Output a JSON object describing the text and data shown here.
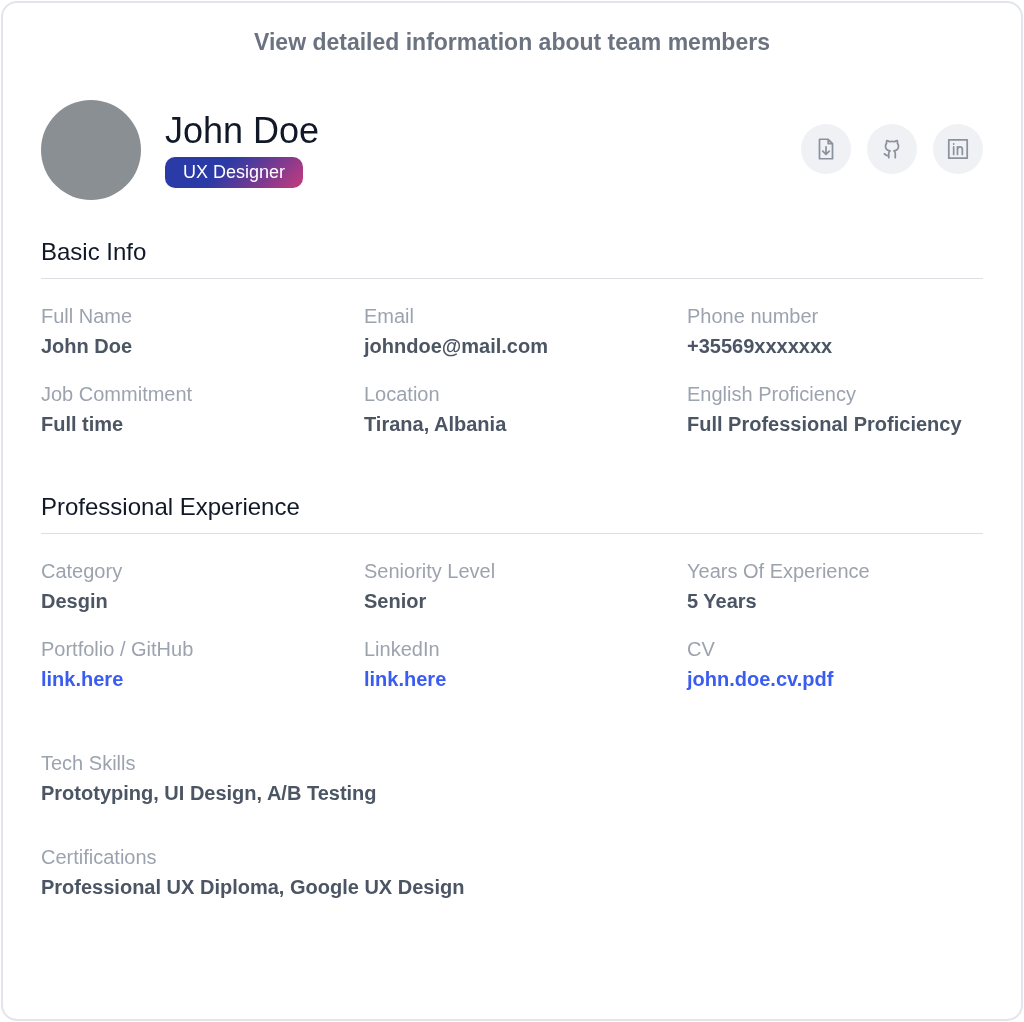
{
  "header": "View detailed information about team members",
  "profile": {
    "name": "John Doe",
    "role": "UX Designer"
  },
  "actions": [
    {
      "kind": "file-download"
    },
    {
      "kind": "github"
    },
    {
      "kind": "linkedin"
    }
  ],
  "sections": [
    {
      "title": "Basic Info",
      "fields": [
        {
          "label": "Full Name",
          "value": "John Doe",
          "kind": "text"
        },
        {
          "label": "Email",
          "value": "johndoe@mail.com",
          "kind": "text"
        },
        {
          "label": "Phone number",
          "value": "+35569xxxxxxx",
          "kind": "text"
        },
        {
          "label": "Job Commitment",
          "value": "Full time",
          "kind": "text"
        },
        {
          "label": "Location",
          "value": "Tirana, Albania",
          "kind": "text"
        },
        {
          "label": "English Proficiency",
          "value": "Full Professional Proficiency",
          "kind": "text"
        }
      ]
    },
    {
      "title": "Professional Experience",
      "fields": [
        {
          "label": "Category",
          "value": "Desgin",
          "kind": "text"
        },
        {
          "label": "Seniority Level",
          "value": "Senior",
          "kind": "text"
        },
        {
          "label": "Years Of Experience",
          "value": "5 Years",
          "kind": "text"
        },
        {
          "label": "Portfolio / GitHub",
          "value": "link.here",
          "kind": "link"
        },
        {
          "label": "LinkedIn",
          "value": "link.here",
          "kind": "link"
        },
        {
          "label": "CV",
          "value": "john.doe.cv.pdf",
          "kind": "link"
        }
      ]
    }
  ],
  "extra_fields": [
    {
      "label": "Tech Skills",
      "value": "Prototyping, UI Design, A/B Testing"
    },
    {
      "label": "Certifications",
      "value": "Professional UX Diploma, Google UX Design"
    }
  ]
}
